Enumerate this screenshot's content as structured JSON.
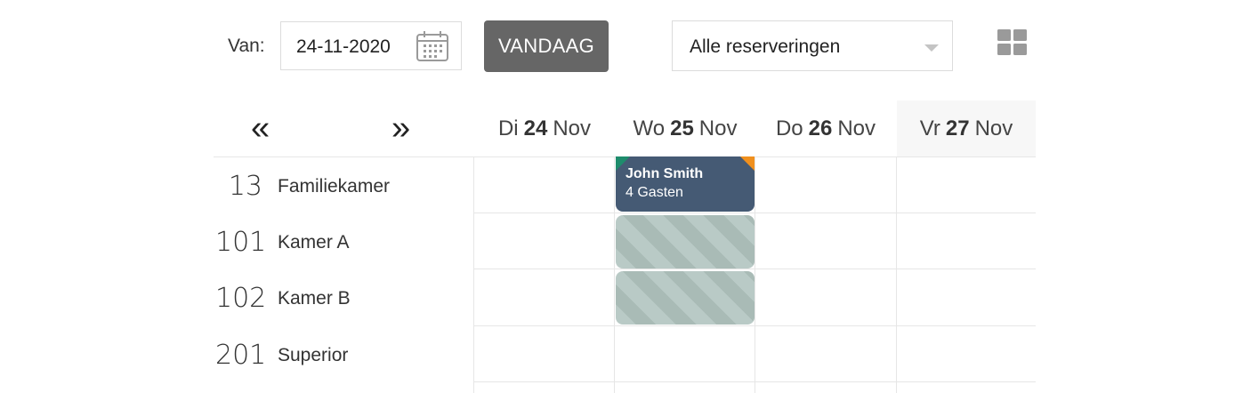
{
  "toolbar": {
    "from_label": "Van:",
    "date_value": "24-11-2020",
    "today_label": "VANDAAG",
    "filter_value": "Alle reserveringen"
  },
  "nav": {
    "prev_symbol": "«",
    "next_symbol": "»"
  },
  "days": [
    {
      "weekday": "Di",
      "day": "24",
      "month": "Nov"
    },
    {
      "weekday": "Wo",
      "day": "25",
      "month": "Nov"
    },
    {
      "weekday": "Do",
      "day": "26",
      "month": "Nov"
    },
    {
      "weekday": "Vr",
      "day": "27",
      "month": "Nov"
    }
  ],
  "rooms": [
    {
      "number": "13",
      "name": "Familiekamer"
    },
    {
      "number": "101",
      "name": "Kamer A"
    },
    {
      "number": "102",
      "name": "Kamer B"
    },
    {
      "number": "201",
      "name": "Superior"
    }
  ],
  "bookings": [
    {
      "guest": "John Smith",
      "guests_text": "4 Gasten"
    }
  ],
  "colors": {
    "booking": "#455a74",
    "checkin_marker": "#1e8c6c",
    "checkout_marker": "#f0901e",
    "today_button": "#666666"
  }
}
